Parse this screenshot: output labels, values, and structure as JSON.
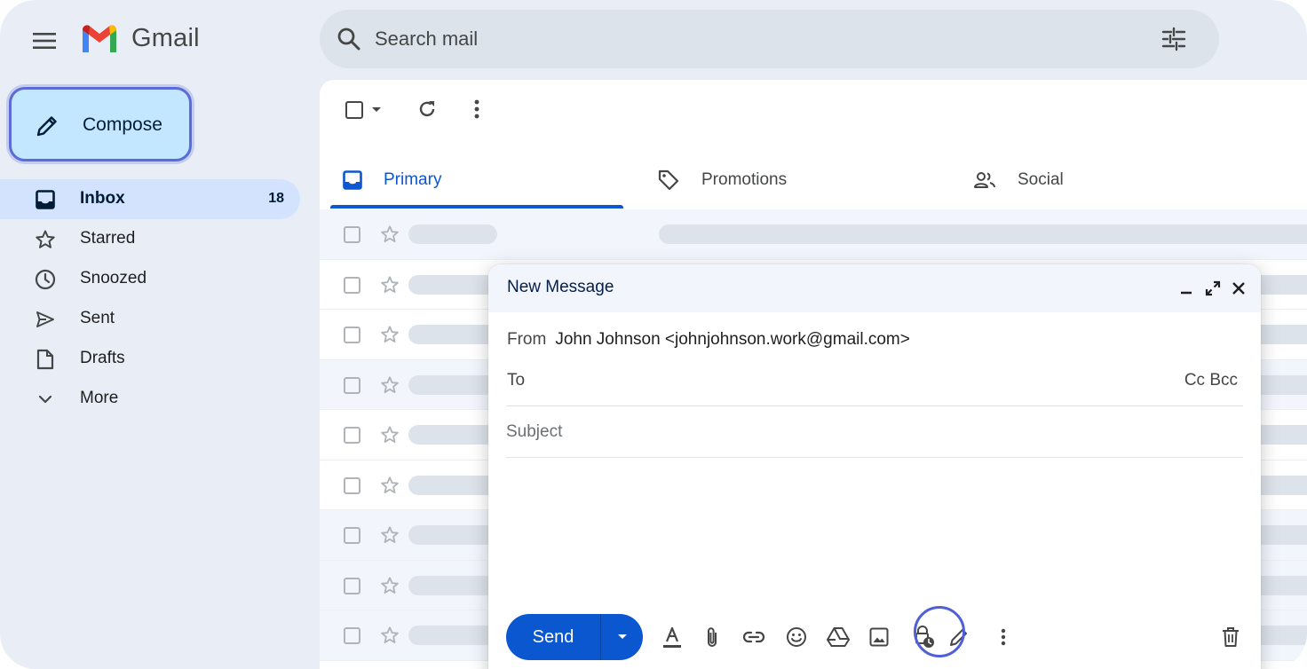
{
  "app": {
    "name": "Gmail"
  },
  "search": {
    "placeholder": "Search mail"
  },
  "sidebar": {
    "compose_label": "Compose",
    "items": [
      {
        "label": "Inbox",
        "count": "18",
        "icon": "inbox-icon",
        "active": true
      },
      {
        "label": "Starred",
        "count": "",
        "icon": "star-icon"
      },
      {
        "label": "Snoozed",
        "count": "",
        "icon": "clock-icon"
      },
      {
        "label": "Sent",
        "count": "",
        "icon": "send-icon"
      },
      {
        "label": "Drafts",
        "count": "",
        "icon": "draft-icon"
      },
      {
        "label": "More",
        "count": "",
        "icon": "chevron-down-icon"
      }
    ]
  },
  "tabs": [
    {
      "label": "Primary",
      "icon": "inbox-icon",
      "active": true
    },
    {
      "label": "Promotions",
      "icon": "tag-icon"
    },
    {
      "label": "Social",
      "icon": "people-icon"
    }
  ],
  "compose": {
    "title": "New Message",
    "from_label": "From",
    "from_value": "John Johnson <johnjohnson.work@gmail.com>",
    "to_label": "To",
    "cc_bcc": "Cc Bcc",
    "subject_placeholder": "Subject",
    "send_label": "Send"
  },
  "colors": {
    "accent": "#0b57d0",
    "compose_bg": "#c2e7ff",
    "highlight_ring": "#5b6bd9",
    "app_bg": "#e9eef6"
  }
}
